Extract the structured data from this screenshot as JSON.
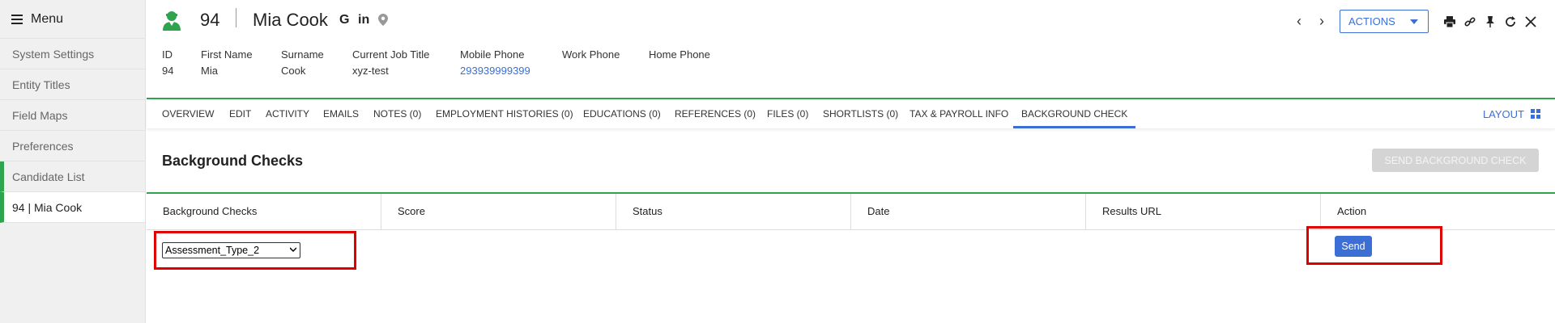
{
  "sidebar": {
    "menu_label": "Menu",
    "items": [
      {
        "label": "System Settings"
      },
      {
        "label": "Entity Titles"
      },
      {
        "label": "Field Maps"
      },
      {
        "label": "Preferences"
      },
      {
        "label": "Candidate List"
      },
      {
        "label": "94 | Mia Cook"
      }
    ]
  },
  "header": {
    "record_id": "94",
    "record_name": "Mia Cook",
    "actions_label": "ACTIONS"
  },
  "info": {
    "labels": [
      "ID",
      "First Name",
      "Surname",
      "Current Job Title",
      "Mobile Phone",
      "Work Phone",
      "Home Phone"
    ],
    "values": [
      "94",
      "Mia",
      "Cook",
      "xyz-test",
      "293939999399",
      "",
      ""
    ]
  },
  "tabs": [
    {
      "label": "OVERVIEW"
    },
    {
      "label": "EDIT"
    },
    {
      "label": "ACTIVITY"
    },
    {
      "label": "EMAILS"
    },
    {
      "label": "NOTES (0)"
    },
    {
      "label": "EMPLOYMENT HISTORIES (0)"
    },
    {
      "label": "EDUCATIONS (0)"
    },
    {
      "label": "REFERENCES (0)"
    },
    {
      "label": "FILES (0)"
    },
    {
      "label": "SHORTLISTS (0)"
    },
    {
      "label": "TAX & PAYROLL INFO"
    },
    {
      "label": "BACKGROUND CHECK"
    }
  ],
  "layout_label": "LAYOUT",
  "section": {
    "title": "Background Checks",
    "send_all_label": "SEND BACKGROUND CHECK"
  },
  "table": {
    "columns": [
      "Background Checks",
      "Score",
      "Status",
      "Date",
      "Results URL",
      "Action"
    ],
    "row": {
      "selected_check": "Assessment_Type_2",
      "send_label": "Send"
    }
  },
  "colors": {
    "accent_green": "#2ea44f",
    "accent_blue": "#3b6fd6",
    "highlight_red": "#e00000"
  }
}
